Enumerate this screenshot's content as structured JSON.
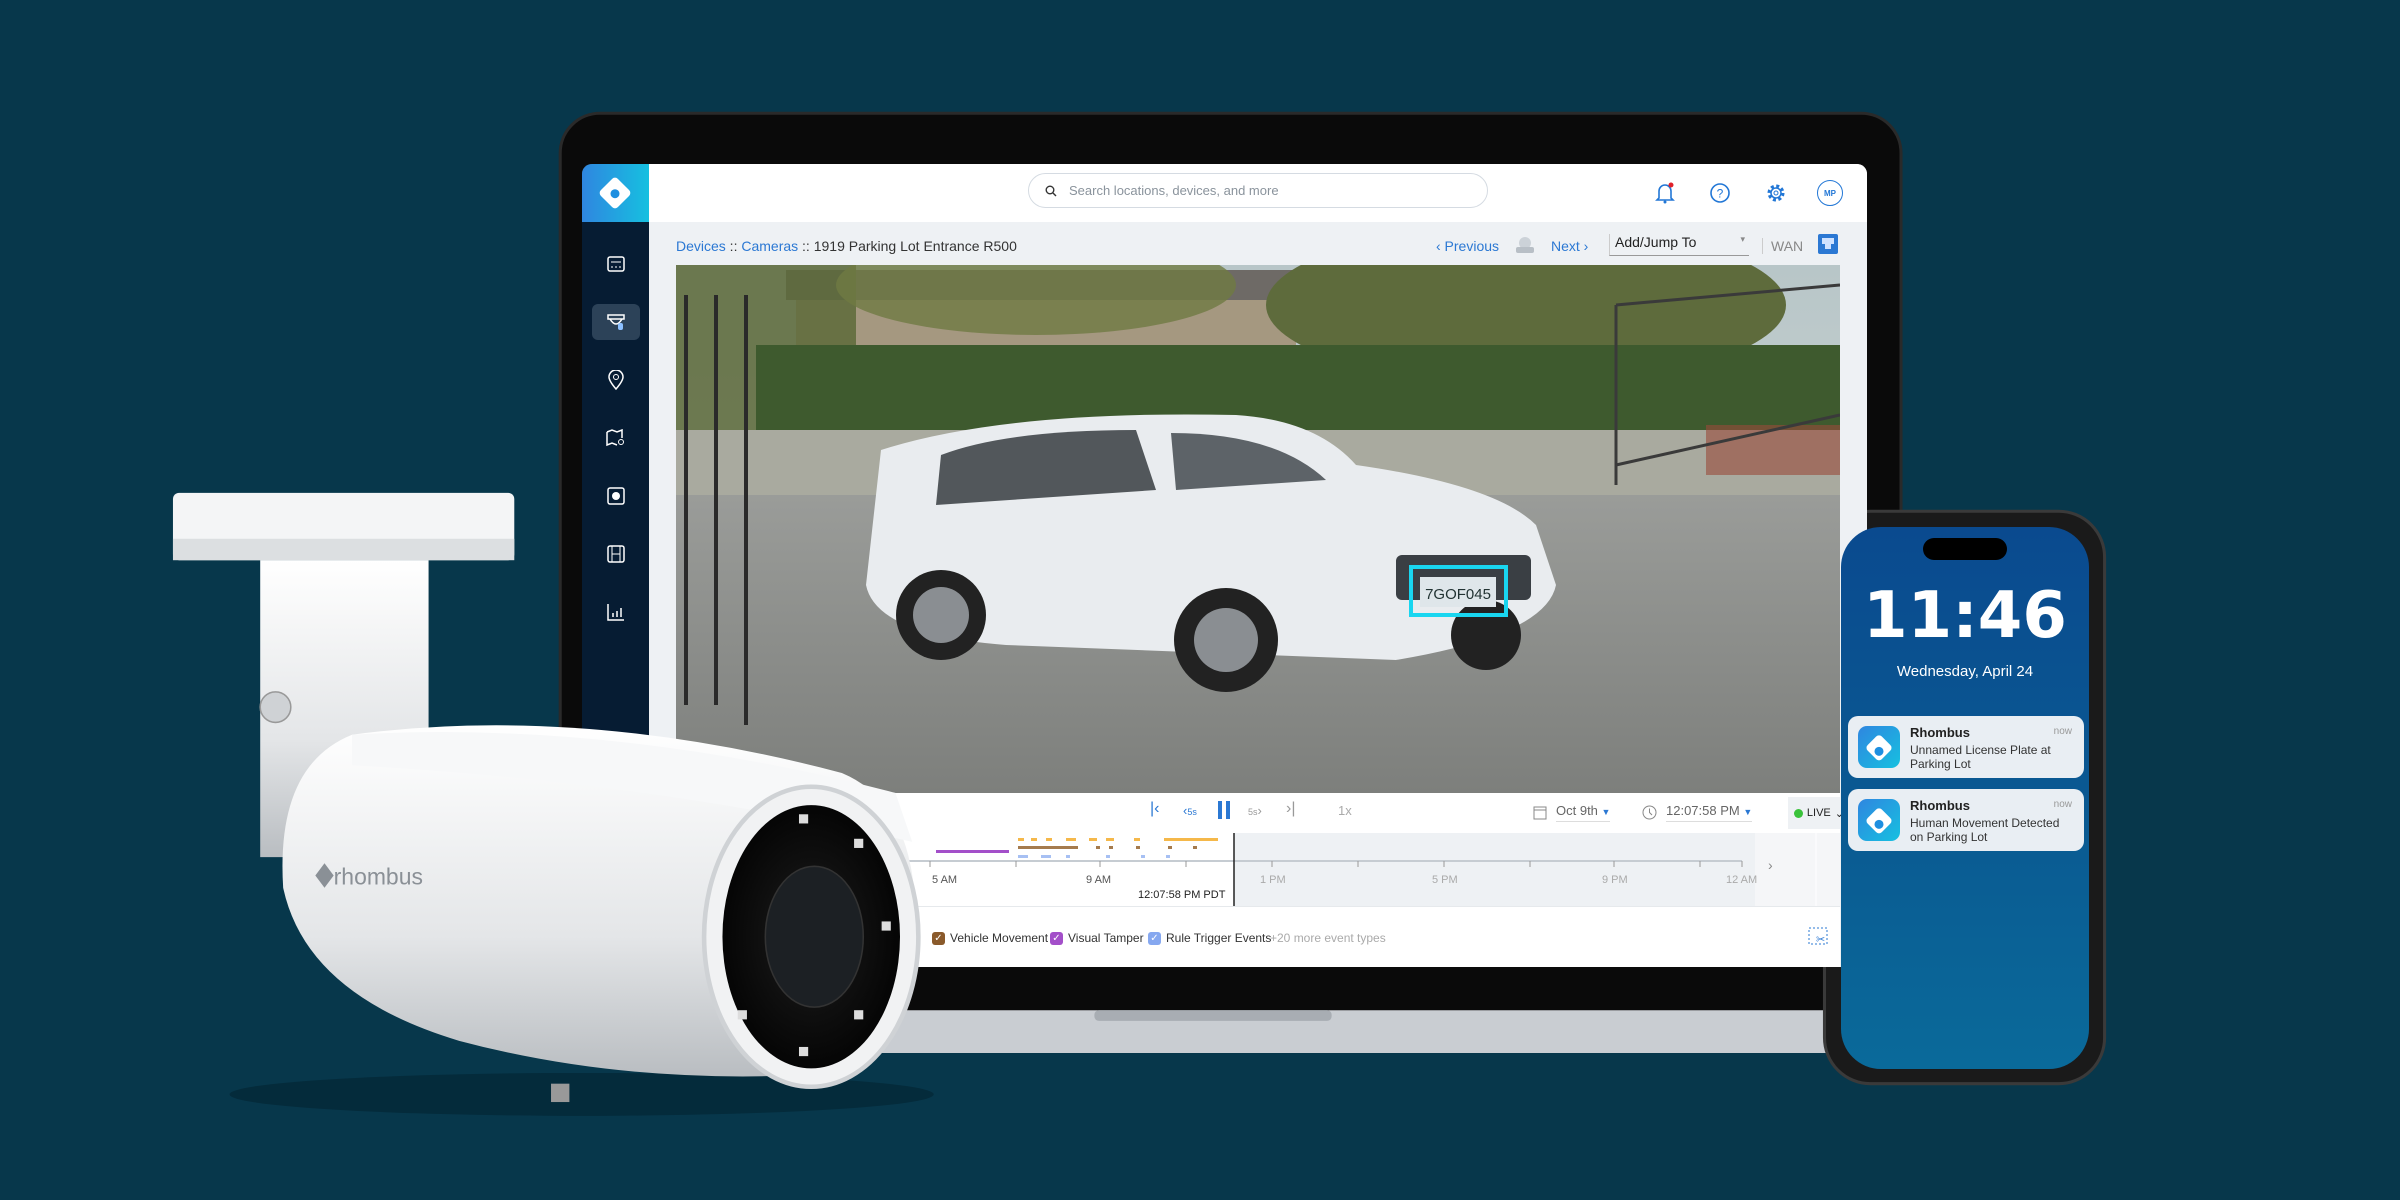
{
  "colors": {
    "background": "#07374b",
    "brand_gradient_start": "#2f86e0",
    "brand_gradient_end": "#16c0e0",
    "sidebar": "#061c33",
    "link": "#2b78d3",
    "plate_highlight": "#19d6f0",
    "live": "#3ac23a"
  },
  "sidebar": {
    "items": [
      {
        "icon": "dashboard-icon",
        "active": false
      },
      {
        "icon": "camera-icon",
        "active": true
      },
      {
        "icon": "location-pin-icon",
        "active": false
      },
      {
        "icon": "map-search-icon",
        "active": false
      },
      {
        "icon": "sensor-icon",
        "active": false
      },
      {
        "icon": "film-icon",
        "active": false
      },
      {
        "icon": "chart-icon",
        "active": false
      }
    ]
  },
  "topbar": {
    "search_placeholder": "Search locations, devices, and more",
    "avatar": "MP",
    "notification_dot": true
  },
  "breadcrumb": {
    "devices": "Devices",
    "sep": " :: ",
    "cameras": "Cameras",
    "current": "1919 Parking Lot Entrance R500"
  },
  "nav": {
    "previous": "‹ Previous",
    "next": "Next ›",
    "jump": "Add/Jump To",
    "network": "WAN"
  },
  "video": {
    "plate_text": "7GOF045"
  },
  "controls": {
    "skip_back": "5s",
    "skip_fwd": "5s",
    "speed": "1x",
    "date": "Oct 9th",
    "time": "12:07:58 PM",
    "live": "LIVE"
  },
  "timeline": {
    "ticks": [
      "5 AM",
      "9 AM",
      "1 PM",
      "5 PM",
      "9 PM",
      "12 AM"
    ],
    "playhead": "12:07:58 PM PDT"
  },
  "legend": {
    "items": [
      {
        "label": "Vehicle Movement",
        "color": "#8a5a2b"
      },
      {
        "label": "Visual Tamper",
        "color": "#a34fc9"
      },
      {
        "label": "Rule Trigger Events",
        "color": "#86a8f0"
      }
    ],
    "more": "+20 more event types"
  },
  "camera": {
    "brand": "rhombus"
  },
  "phone": {
    "time": "11:46",
    "date": "Wednesday, April 24",
    "notifications": [
      {
        "app": "Rhombus",
        "text": "Unnamed License Plate at Parking Lot",
        "when": "now"
      },
      {
        "app": "Rhombus",
        "text": "Human Movement Detected on Parking Lot",
        "when": "now"
      }
    ]
  }
}
